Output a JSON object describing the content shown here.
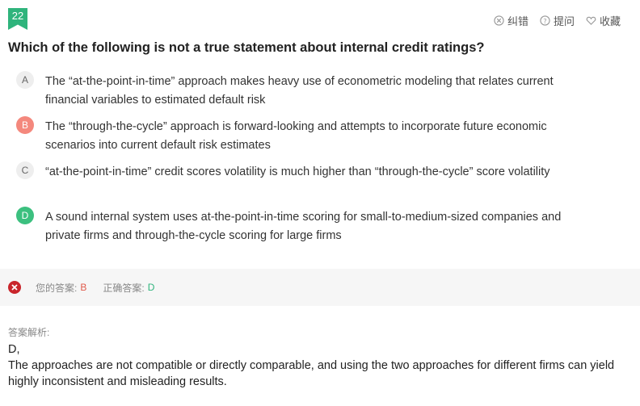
{
  "question": {
    "number": "22",
    "text": "Which of the following is not a true statement about internal credit ratings?"
  },
  "toolbar": {
    "report_label": "纠错",
    "ask_label": "提问",
    "favorite_label": "收藏"
  },
  "options": [
    {
      "letter": "A",
      "text": "The “at-the-point-in-time” approach makes heavy use of econometric modeling that relates current financial variables to estimated default risk"
    },
    {
      "letter": "B",
      "text": "The “through-the-cycle” approach is forward-looking and attempts to incorporate future economic scenarios into current default risk estimates"
    },
    {
      "letter": "C",
      "text": " “at-the-point-in-time” credit scores volatility is much higher than “through-the-cycle” score volatility"
    },
    {
      "letter": "D",
      "text": "A sound internal system uses at-the-point-in-time scoring for small-to-medium-sized companies and private firms and through-the-cycle scoring for large firms"
    }
  ],
  "result": {
    "your_answer_label": "您的答案:",
    "your_answer": "B",
    "correct_answer_label": "正确答案:",
    "correct_answer": "D"
  },
  "analysis": {
    "title": "答案解析:",
    "answer_line": "D,",
    "body": "The approaches are not compatible or directly comparable, and using the two approaches for different firms can yield highly inconsistent and misleading results."
  },
  "colors": {
    "badge": "#2fb47c",
    "wrong": "#e05a4b",
    "right": "#2fb47c"
  }
}
